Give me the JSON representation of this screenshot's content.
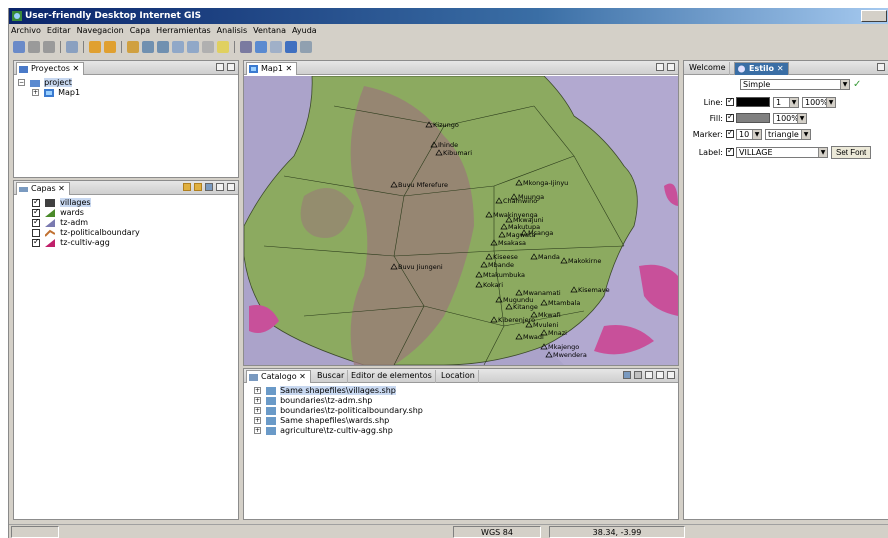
{
  "window": {
    "title": "User-friendly Desktop Internet GIS"
  },
  "menu": [
    "Archivo",
    "Editar",
    "Navegacion",
    "Capa",
    "Herramientas",
    "Analisis",
    "Ventana",
    "Ayuda"
  ],
  "projects": {
    "tab_label": "Proyectos",
    "items": [
      {
        "label": "project"
      },
      {
        "label": "Map1"
      }
    ]
  },
  "layers": {
    "tab_label": "Capas",
    "items": [
      {
        "label": "villages",
        "checked": true,
        "color": "#404040"
      },
      {
        "label": "wards",
        "checked": true,
        "color": "#4a8a2a"
      },
      {
        "label": "tz-adm",
        "checked": true,
        "color": "#7a7ab0"
      },
      {
        "label": "tz-politicalboundary",
        "checked": false,
        "color": "#c07030"
      },
      {
        "label": "tz-cultiv-agg",
        "checked": true,
        "color": "#c0206a"
      }
    ]
  },
  "map": {
    "tab_label": "Map1",
    "colors": {
      "water": "#b2a9d0",
      "land": "#8caa60",
      "cultivation": "#9a7a78",
      "highlight": "#c8509a"
    },
    "labels": [
      "Kizungo",
      "Ihinde",
      "Kibumari",
      "Buvu Mferefure",
      "Mkonga-Ijinyu",
      "Muunga",
      "Chamwino",
      "Mwakinyenga",
      "Mkwajuni",
      "Makutupa",
      "Magwata",
      "Msanga",
      "Msakasa",
      "Kiseese",
      "Mbande",
      "Manda",
      "Makokirne",
      "Buvu Jiungeni",
      "Mtakumbuka",
      "Kisemave",
      "Mtambala",
      "Mwanamati",
      "Mkwafi",
      "Mvuleni",
      "Mnazi",
      "Kitange",
      "Kiberenjero",
      "Mkajengo",
      "Mwendera",
      "Mwadi",
      "Kokari",
      "Mugundu"
    ]
  },
  "catalog": {
    "tabs": [
      "Catalogo",
      "Buscar",
      "Editor de elementos",
      "Location"
    ],
    "items": [
      "Same shapefiles\\villages.shp",
      "boundaries\\tz-adm.shp",
      "boundaries\\tz-politicalboundary.shp",
      "Same shapefiles\\wards.shp",
      "agriculture\\tz-cultiv-agg.shp"
    ]
  },
  "style": {
    "tabs": [
      "Welcome",
      "Estilo"
    ],
    "mode": "Simple",
    "line_label": "Line:",
    "line_width": "1",
    "line_opacity": "100%",
    "fill_label": "Fill:",
    "fill_opacity": "100%",
    "marker_label": "Marker:",
    "marker_size": "10",
    "marker_shape": "triangle",
    "label_label": "Label:",
    "label_field": "VILLAGE",
    "set_font": "Set Font",
    "line_color": "#000000",
    "fill_color": "#808080"
  },
  "status": {
    "crs": "WGS 84",
    "coords": "38.34, -3.99"
  }
}
